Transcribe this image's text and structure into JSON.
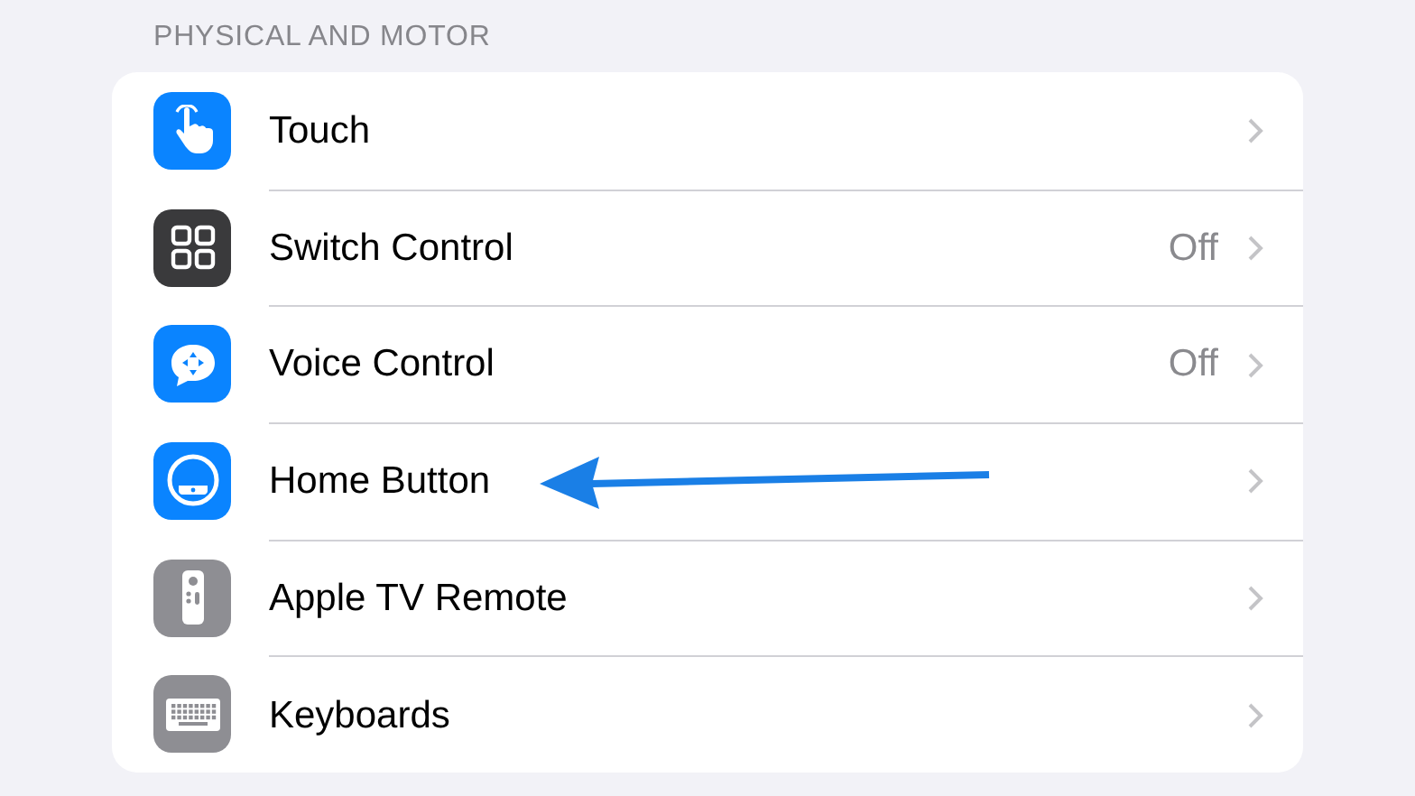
{
  "section_header": "PHYSICAL AND MOTOR",
  "rows": [
    {
      "label": "Touch",
      "kind": "hand",
      "color": "#0a84ff",
      "arrow_pointer": false
    },
    {
      "label": "Switch Control",
      "value": "Off",
      "kind": "grid",
      "color": "#3a3a3c",
      "arrow_pointer": false
    },
    {
      "label": "Voice Control",
      "value": "Off",
      "kind": "bubble",
      "color": "#0a84ff",
      "arrow_pointer": false
    },
    {
      "label": "Home Button",
      "kind": "home",
      "color": "#0a84ff",
      "arrow_pointer": true
    },
    {
      "label": "Apple TV Remote",
      "kind": "remote",
      "color": "#8e8e93",
      "arrow_pointer": false
    },
    {
      "label": "Keyboards",
      "kind": "keyboard",
      "color": "#8e8e93",
      "arrow_pointer": false
    }
  ]
}
